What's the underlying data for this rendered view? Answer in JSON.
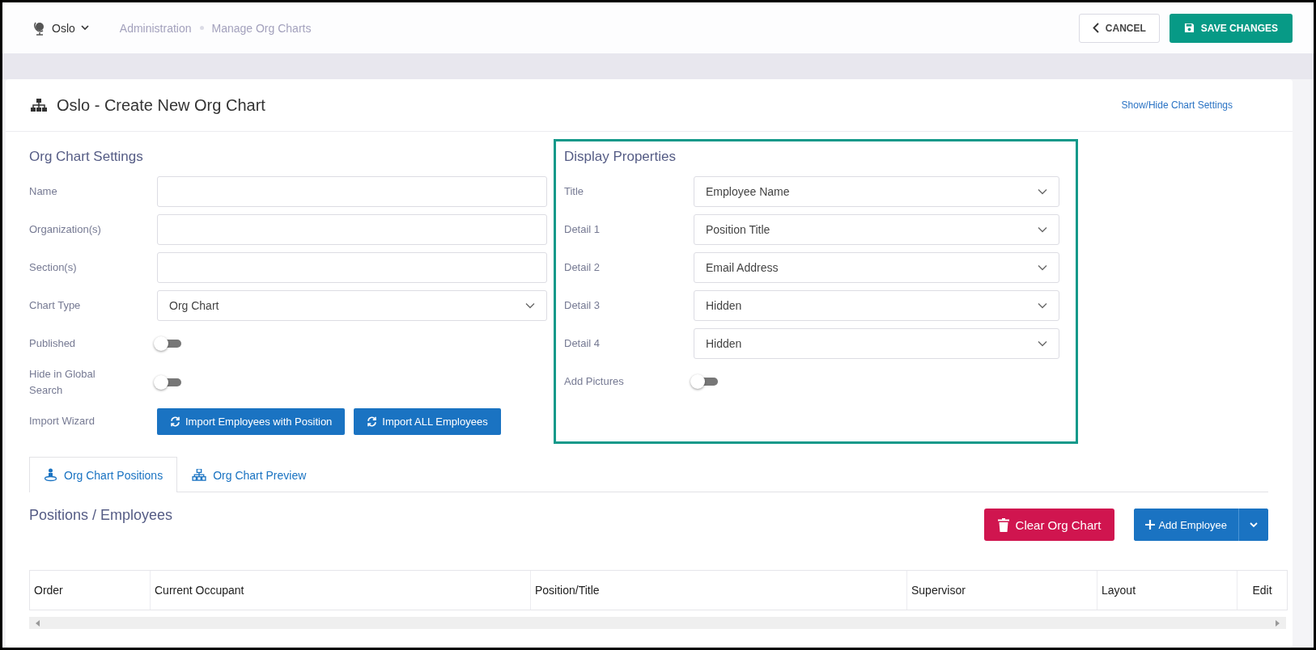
{
  "header": {
    "location": "Oslo",
    "breadcrumb": [
      "Administration",
      "Manage Org Charts"
    ],
    "cancel_button": "CANCEL",
    "save_button": "SAVE CHANGES"
  },
  "page": {
    "title": "Oslo - Create New Org Chart",
    "settings_link": "Show/Hide Chart Settings"
  },
  "org_chart_settings": {
    "heading": "Org Chart Settings",
    "fields": [
      {
        "kind": "text",
        "label": "Name"
      },
      {
        "kind": "text",
        "label": "Organization(s)"
      },
      {
        "kind": "text",
        "label": "Section(s)"
      },
      {
        "kind": "select",
        "label": "Chart Type",
        "value": "Org Chart"
      },
      {
        "kind": "toggle",
        "label": "Published",
        "on": false
      },
      {
        "kind": "toggle",
        "label": "Hide in Global Search",
        "on": false
      },
      {
        "kind": "buttons",
        "label": "Import Wizard",
        "buttons": [
          "Import Employees with Position",
          "Import ALL Employees"
        ]
      }
    ]
  },
  "display_properties": {
    "heading": "Display Properties",
    "fields": [
      {
        "kind": "select",
        "label": "Title",
        "value": "Employee Name"
      },
      {
        "kind": "select",
        "label": "Detail 1",
        "value": "Position Title"
      },
      {
        "kind": "select",
        "label": "Detail 2",
        "value": "Email Address"
      },
      {
        "kind": "select",
        "label": "Detail 3",
        "value": "Hidden"
      },
      {
        "kind": "select",
        "label": "Detail 4",
        "value": "Hidden"
      },
      {
        "kind": "toggle",
        "label": "Add Pictures",
        "on": false
      }
    ]
  },
  "tabs": [
    {
      "label": "Org Chart Positions",
      "selected": true
    },
    {
      "label": "Org Chart Preview",
      "selected": false
    }
  ],
  "positions": {
    "heading": "Positions / Employees",
    "clear_button": "Clear Org Chart",
    "add_button": "Add Employee"
  },
  "table": {
    "columns": [
      "Order",
      "Current Occupant",
      "Position/Title",
      "Supervisor",
      "Layout",
      "Edit"
    ]
  }
}
